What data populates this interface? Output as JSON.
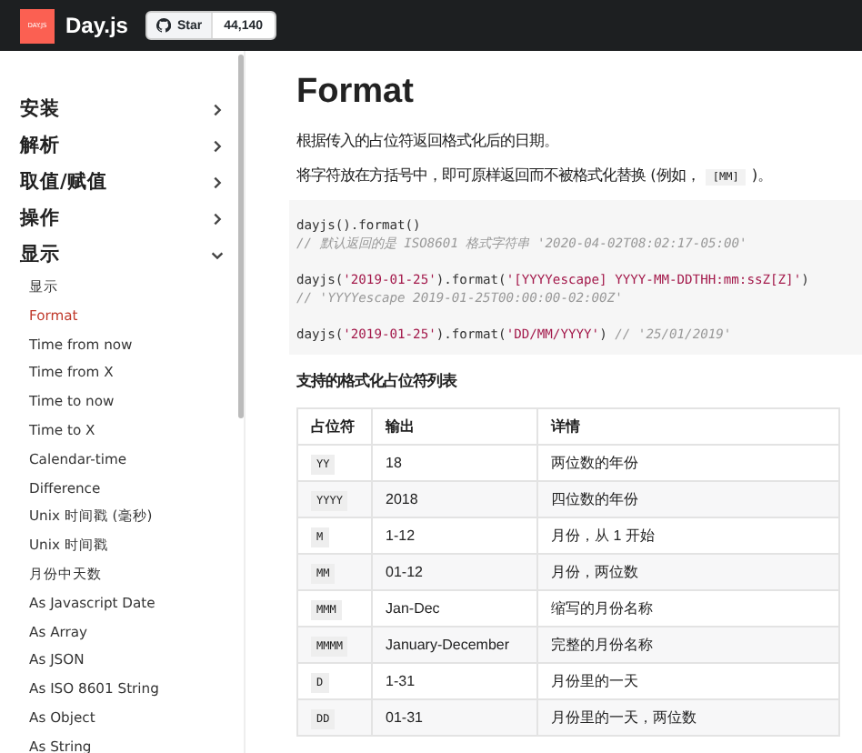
{
  "header": {
    "logo": "DAY.JS",
    "title": "Day.js",
    "star_button": {
      "label": "Star",
      "count": "44,140"
    }
  },
  "sidebar": {
    "items": [
      {
        "label": "安装",
        "expanded": false
      },
      {
        "label": "解析",
        "expanded": false
      },
      {
        "label": "取值/赋值",
        "expanded": false
      },
      {
        "label": "操作",
        "expanded": false
      },
      {
        "label": "显示",
        "expanded": true,
        "children": [
          {
            "label": "显示",
            "selected": false
          },
          {
            "label": "Format",
            "selected": true
          },
          {
            "label": "Time from now",
            "selected": false
          },
          {
            "label": "Time from X",
            "selected": false
          },
          {
            "label": "Time to now",
            "selected": false
          },
          {
            "label": "Time to X",
            "selected": false
          },
          {
            "label": "Calendar-time",
            "selected": false
          },
          {
            "label": "Difference",
            "selected": false
          },
          {
            "label": "Unix 时间戳 (毫秒)",
            "selected": false
          },
          {
            "label": "Unix 时间戳",
            "selected": false
          },
          {
            "label": "月份中天数",
            "selected": false
          },
          {
            "label": "As Javascript Date",
            "selected": false
          },
          {
            "label": "As Array",
            "selected": false
          },
          {
            "label": "As JSON",
            "selected": false
          },
          {
            "label": "As ISO 8601 String",
            "selected": false
          },
          {
            "label": "As Object",
            "selected": false
          },
          {
            "label": "As String",
            "selected": false
          }
        ]
      }
    ]
  },
  "content": {
    "title": "Format",
    "paragraphs": [
      [
        {
          "kind": "text",
          "text": "根据传入的占位符返回格式化后的日期。"
        }
      ],
      [
        {
          "kind": "text",
          "text": "将字符放在方括号中，即可原样返回而不被格式化替换 (例如，"
        },
        {
          "kind": "code",
          "text": "[MM]"
        },
        {
          "kind": "text",
          "text": ")。"
        }
      ]
    ],
    "code_blocks": [
      [
        [
          {
            "kind": "plain",
            "text": "dayjs().format()"
          }
        ],
        [
          {
            "kind": "comment",
            "text": "// 默认返回的是 ISO8601 格式字符串 '2020-04-02T08:02:17-05:00'"
          }
        ]
      ],
      [
        [
          {
            "kind": "plain",
            "text": "dayjs("
          },
          {
            "kind": "string",
            "text": "'2019-01-25'"
          },
          {
            "kind": "plain",
            "text": ").format("
          },
          {
            "kind": "string",
            "text": "'[YYYYescape] YYYY-MM-DDTHH:mm:ssZ[Z]'"
          },
          {
            "kind": "plain",
            "text": ")"
          }
        ],
        [
          {
            "kind": "comment",
            "text": "// 'YYYYescape 2019-01-25T00:00:00-02:00Z'"
          }
        ]
      ],
      [
        [
          {
            "kind": "plain",
            "text": "dayjs("
          },
          {
            "kind": "string",
            "text": "'2019-01-25'"
          },
          {
            "kind": "plain",
            "text": ").format("
          },
          {
            "kind": "string",
            "text": "'DD/MM/YYYY'"
          },
          {
            "kind": "plain",
            "text": ")"
          },
          {
            "kind": "comment",
            "text": " // '25/01/2019'"
          }
        ]
      ]
    ],
    "table_title": "支持的格式化占位符列表",
    "table": {
      "columns": [
        "占位符",
        "输出",
        "详情"
      ],
      "rows": [
        [
          "YY",
          "18",
          "两位数的年份"
        ],
        [
          "YYYY",
          "2018",
          "四位数的年份"
        ],
        [
          "M",
          "1-12",
          "月份，从 1 开始"
        ],
        [
          "MM",
          "01-12",
          "月份，两位数"
        ],
        [
          "MMM",
          "Jan-Dec",
          "缩写的月份名称"
        ],
        [
          "MMMM",
          "January-December",
          "完整的月份名称"
        ],
        [
          "D",
          "1-31",
          "月份里的一天"
        ],
        [
          "DD",
          "01-31",
          "月份里的一天，两位数"
        ]
      ]
    }
  }
}
